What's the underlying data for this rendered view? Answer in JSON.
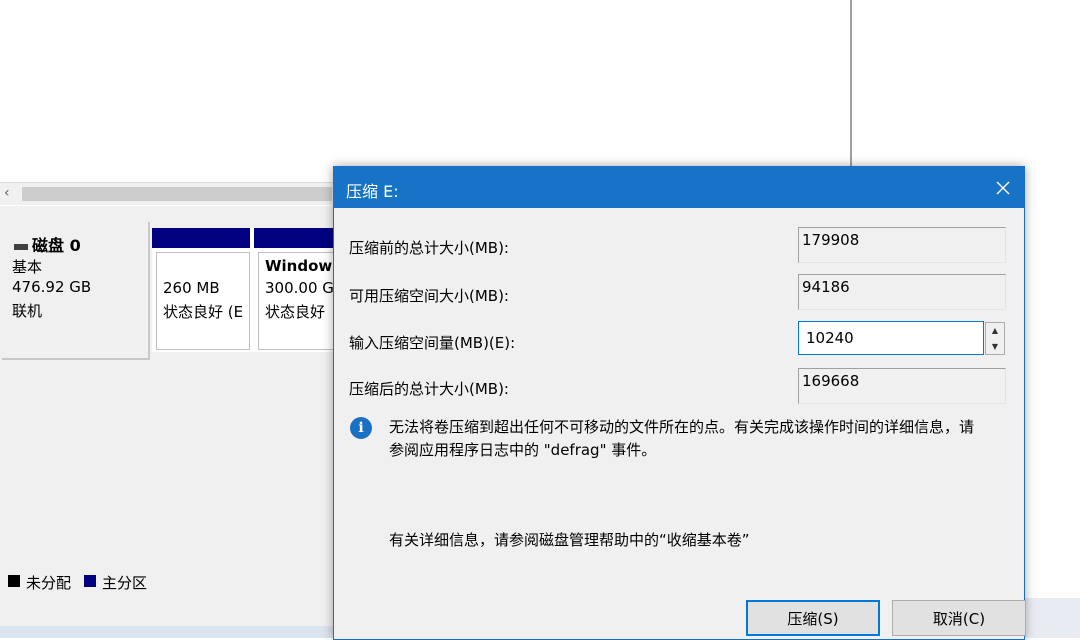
{
  "background": {
    "scroll_left": "‹",
    "disk": {
      "name": "磁盘 0",
      "type": "基本",
      "size": "476.92 GB",
      "status": "联机"
    },
    "partitions": [
      {
        "title": "",
        "size": "260 MB",
        "status": "状态良好 (E"
      },
      {
        "title": "Windows",
        "size": "300.00 G",
        "status": "状态良好"
      }
    ],
    "legend": [
      {
        "label": "未分配",
        "color": "#000000"
      },
      {
        "label": "主分区",
        "color": "#000080"
      }
    ]
  },
  "dialog": {
    "title": "压缩 E:",
    "close_icon": "close-icon",
    "rows": {
      "total_before_label": "压缩前的总计大小(MB):",
      "total_before_value": "179908",
      "available_label": "可用压缩空间大小(MB):",
      "available_value": "94186",
      "amount_label": "输入压缩空间量(MB)(E):",
      "amount_value": "10240",
      "total_after_label": "压缩后的总计大小(MB):",
      "total_after_value": "169668"
    },
    "info_icon": "info-icon",
    "info_text_1": "无法将卷压缩到超出任何不可移动的文件所在的点。有关完成该操作时间的详细信息，请",
    "info_text_2": "参阅应用程序日志中的 \"defrag\" 事件。",
    "help_text": "有关详细信息，请参阅磁盘管理帮助中的“收缩基本卷”",
    "shrink_label": "压缩(S)",
    "cancel_label": "取消(C)"
  },
  "colors": {
    "titlebar": "#1673c6",
    "primary_partition": "#000080",
    "focus_border": "#0078d7"
  }
}
